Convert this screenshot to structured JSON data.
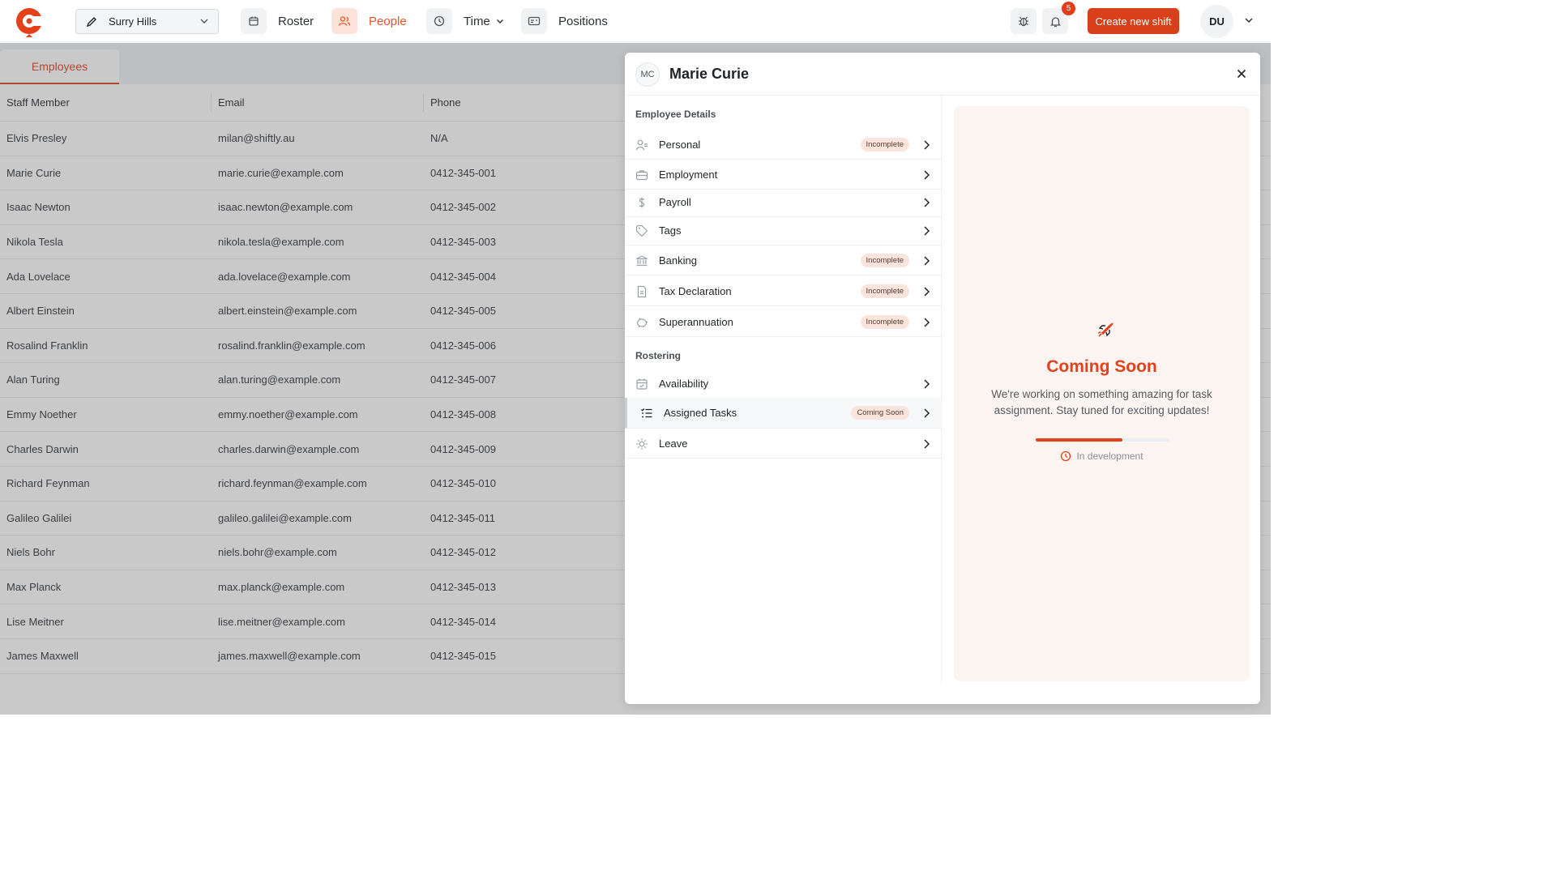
{
  "topbar": {
    "location": "Surry Hills",
    "nav": [
      {
        "label": "Roster",
        "icon": "calendar-icon"
      },
      {
        "label": "People",
        "icon": "people-icon",
        "active": true
      },
      {
        "label": "Time",
        "icon": "clock-icon"
      },
      {
        "label": "Positions",
        "icon": "id-card-icon"
      }
    ],
    "notification_count": "5",
    "create_label": "Create new shift",
    "user_initials": "DU"
  },
  "employees": {
    "tab_label": "Employees",
    "columns": [
      "Staff Member",
      "Email",
      "Phone"
    ],
    "rows": [
      {
        "name": "Elvis Presley",
        "email": "milan@shiftly.au",
        "phone": "N/A"
      },
      {
        "name": "Marie Curie",
        "email": "marie.curie@example.com",
        "phone": "0412-345-001"
      },
      {
        "name": "Isaac Newton",
        "email": "isaac.newton@example.com",
        "phone": "0412-345-002"
      },
      {
        "name": "Nikola Tesla",
        "email": "nikola.tesla@example.com",
        "phone": "0412-345-003"
      },
      {
        "name": "Ada Lovelace",
        "email": "ada.lovelace@example.com",
        "phone": "0412-345-004"
      },
      {
        "name": "Albert Einstein",
        "email": "albert.einstein@example.com",
        "phone": "0412-345-005"
      },
      {
        "name": "Rosalind Franklin",
        "email": "rosalind.franklin@example.com",
        "phone": "0412-345-006"
      },
      {
        "name": "Alan Turing",
        "email": "alan.turing@example.com",
        "phone": "0412-345-007"
      },
      {
        "name": "Emmy Noether",
        "email": "emmy.noether@example.com",
        "phone": "0412-345-008"
      },
      {
        "name": "Charles Darwin",
        "email": "charles.darwin@example.com",
        "phone": "0412-345-009"
      },
      {
        "name": "Richard Feynman",
        "email": "richard.feynman@example.com",
        "phone": "0412-345-010"
      },
      {
        "name": "Galileo Galilei",
        "email": "galileo.galilei@example.com",
        "phone": "0412-345-011"
      },
      {
        "name": "Niels Bohr",
        "email": "niels.bohr@example.com",
        "phone": "0412-345-012"
      },
      {
        "name": "Max Planck",
        "email": "max.planck@example.com",
        "phone": "0412-345-013"
      },
      {
        "name": "Lise Meitner",
        "email": "lise.meitner@example.com",
        "phone": "0412-345-014"
      },
      {
        "name": "James Maxwell",
        "email": "james.maxwell@example.com",
        "phone": "0412-345-015"
      }
    ]
  },
  "drawer": {
    "initials": "MC",
    "name": "Marie Curie",
    "sections": [
      {
        "title": "Employee Details",
        "items": [
          {
            "label": "Personal",
            "icon": "person-icon",
            "badge": "Incomplete"
          },
          {
            "label": "Employment",
            "icon": "briefcase-icon",
            "badge": ""
          },
          {
            "label": "Payroll",
            "icon": "dollar-icon",
            "badge": ""
          },
          {
            "label": "Tags",
            "icon": "tag-icon",
            "badge": ""
          },
          {
            "label": "Banking",
            "icon": "bank-icon",
            "badge": "Incomplete"
          },
          {
            "label": "Tax Declaration",
            "icon": "document-icon",
            "badge": "Incomplete"
          },
          {
            "label": "Superannuation",
            "icon": "piggy-bank-icon",
            "badge": "Incomplete"
          }
        ]
      },
      {
        "title": "Rostering",
        "items": [
          {
            "label": "Availability",
            "icon": "calendar-check-icon",
            "badge": ""
          },
          {
            "label": "Assigned Tasks",
            "icon": "task-list-icon",
            "badge": "Coming Soon",
            "selected": true
          },
          {
            "label": "Leave",
            "icon": "sun-icon",
            "badge": ""
          }
        ]
      }
    ],
    "pane": {
      "title": "Coming Soon",
      "message": "We're working on something amazing for task assignment. Stay tuned for exciting updates!",
      "progress": 0.65,
      "status": "In development",
      "icon": "rocket-icon"
    }
  },
  "colors": {
    "accent": "#d8401c",
    "accent_light": "#fde3da",
    "overlay": "rgba(92,92,92,0.33)"
  }
}
